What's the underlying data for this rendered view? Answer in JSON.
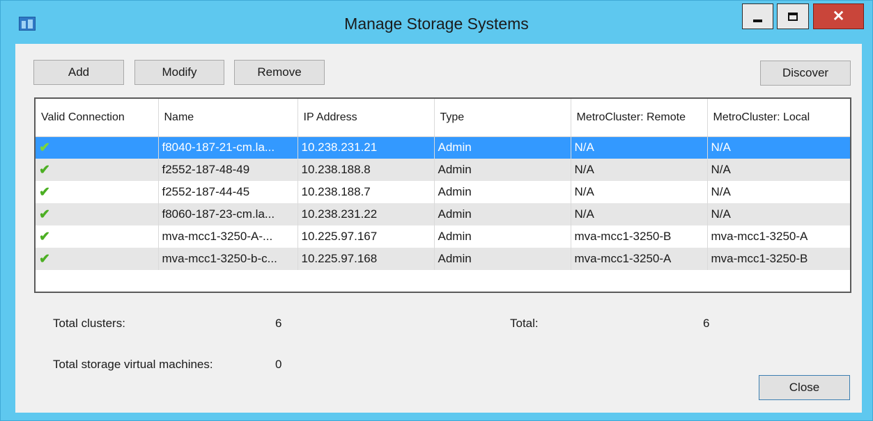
{
  "window": {
    "title": "Manage Storage Systems"
  },
  "toolbar": {
    "add_label": "Add",
    "modify_label": "Modify",
    "remove_label": "Remove",
    "discover_label": "Discover"
  },
  "table": {
    "columns": [
      "Valid Connection",
      "Name",
      "IP Address",
      "Type",
      "MetroCluster: Remote",
      "MetroCluster: Local"
    ],
    "rows": [
      {
        "valid": "✔",
        "name": "f8040-187-21-cm.la...",
        "ip": "10.238.231.21",
        "type": "Admin",
        "mc_remote": "N/A",
        "mc_local": "N/A",
        "selected": true
      },
      {
        "valid": "✔",
        "name": "f2552-187-48-49",
        "ip": "10.238.188.8",
        "type": "Admin",
        "mc_remote": "N/A",
        "mc_local": "N/A"
      },
      {
        "valid": "✔",
        "name": "f2552-187-44-45",
        "ip": "10.238.188.7",
        "type": "Admin",
        "mc_remote": "N/A",
        "mc_local": "N/A"
      },
      {
        "valid": "✔",
        "name": "f8060-187-23-cm.la...",
        "ip": "10.238.231.22",
        "type": "Admin",
        "mc_remote": "N/A",
        "mc_local": "N/A"
      },
      {
        "valid": "✔",
        "name": "mva-mcc1-3250-A-...",
        "ip": "10.225.97.167",
        "type": "Admin",
        "mc_remote": "mva-mcc1-3250-B",
        "mc_local": "mva-mcc1-3250-A"
      },
      {
        "valid": "✔",
        "name": "mva-mcc1-3250-b-c...",
        "ip": "10.225.97.168",
        "type": "Admin",
        "mc_remote": "mva-mcc1-3250-A",
        "mc_local": "mva-mcc1-3250-B"
      }
    ]
  },
  "summary": {
    "total_clusters_label": "Total clusters:",
    "total_clusters_value": "6",
    "total_svm_label": "Total storage virtual machines:",
    "total_svm_value": "0",
    "total_label": "Total:",
    "total_value": "6"
  },
  "footer": {
    "close_label": "Close"
  },
  "colors": {
    "titlebar": "#5ec8ef",
    "selection": "#3399ff",
    "check": "#4caf23",
    "close_button": "#c9453a"
  }
}
